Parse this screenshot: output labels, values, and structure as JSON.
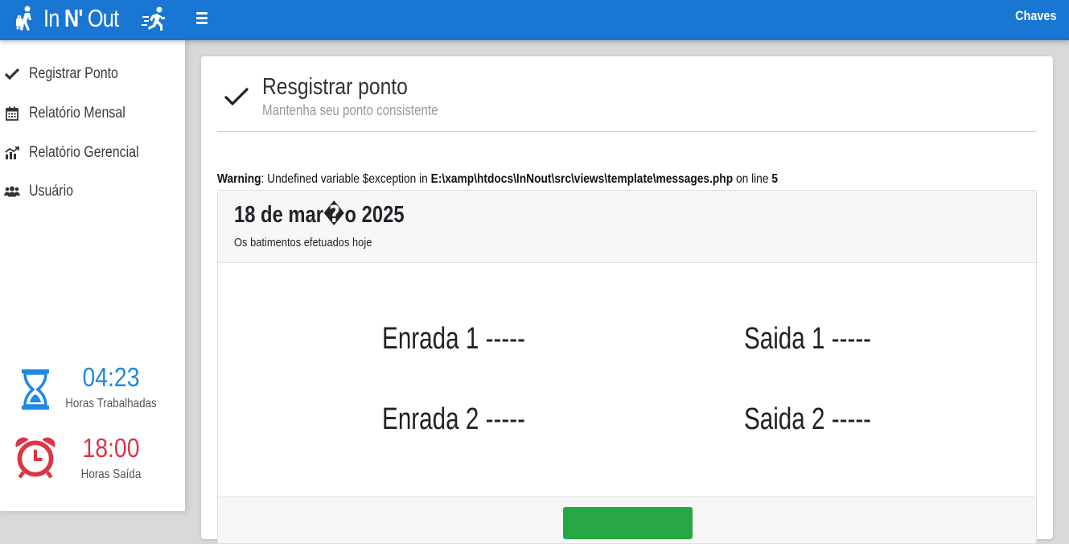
{
  "header": {
    "brand_in": "In",
    "brand_n": "N'",
    "brand_out": "Out",
    "user": "Chaves",
    "color": "#1976d2"
  },
  "sidebar": {
    "items": [
      {
        "label": "Registrar Ponto",
        "icon": "check-icon"
      },
      {
        "label": "Relatório Mensal",
        "icon": "calendar-icon"
      },
      {
        "label": "Relatório Gerencial",
        "icon": "chart-icon"
      },
      {
        "label": "Usuário",
        "icon": "users-icon"
      }
    ],
    "worked": {
      "value": "04:23",
      "caption": "Horas Trabalhadas",
      "color": "#1e88e5",
      "icon": "hourglass-icon"
    },
    "exit": {
      "value": "18:00",
      "caption": "Horas Saída",
      "color": "#dc3545",
      "icon": "alarm-clock-icon"
    }
  },
  "main": {
    "title": "Resgistrar ponto",
    "subtitle": "Mantenha seu ponto consistente",
    "warning": {
      "label": "Warning",
      "text1": ": Undefined variable $exception in ",
      "path": "E:\\xamp\\htdocs\\InNout\\src\\views\\template\\messages.php",
      "text2": " on line ",
      "line": "5"
    },
    "date": "18 de mar�o 2025",
    "date_sub": "Os batimentos efetuados hoje",
    "punches": {
      "in1": "Enrada 1 -----",
      "out1": "Saida 1 -----",
      "in2": "Enrada 2 -----",
      "out2": "Saida 2 -----"
    },
    "button_color": "#28a745"
  }
}
